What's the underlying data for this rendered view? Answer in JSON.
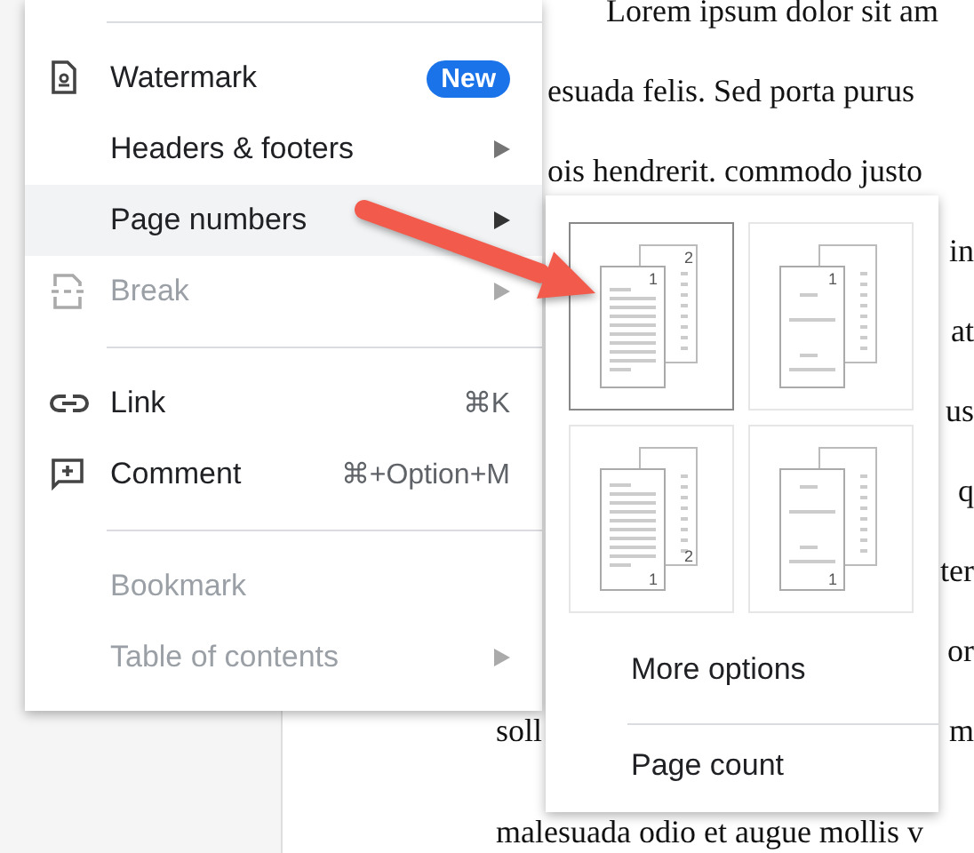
{
  "document": {
    "lines": [
      {
        "text": "Lorem ipsum dolor sit am"
      },
      {
        "text": "esuada felis. Sed porta purus"
      },
      {
        "text": "ois hendrerit. commodo justo"
      },
      {
        "edge_text": "in"
      },
      {
        "edge_text": "at"
      },
      {
        "edge_text": "us"
      },
      {
        "edge_text": "q"
      },
      {
        "edge_text": "ter"
      },
      {
        "edge_text": "or"
      },
      {
        "text": "soll",
        "edge_text": "m"
      },
      {
        "text": "malesuada odio et augue mollis v"
      }
    ]
  },
  "menu": {
    "items": [
      {
        "kind": "watermark",
        "label": "Watermark",
        "badge": "New",
        "submenu": false,
        "disabled": false,
        "selected": false
      },
      {
        "kind": "plain",
        "label": "Headers & footers",
        "submenu": true,
        "disabled": false,
        "selected": false
      },
      {
        "kind": "plain",
        "label": "Page numbers",
        "submenu": true,
        "disabled": false,
        "selected": true
      },
      {
        "kind": "break",
        "label": "Break",
        "submenu": true,
        "disabled": true,
        "selected": false
      },
      {
        "kind": "divider"
      },
      {
        "kind": "link",
        "label": "Link",
        "shortcut": "⌘K",
        "submenu": false,
        "disabled": false,
        "selected": false
      },
      {
        "kind": "comment",
        "label": "Comment",
        "shortcut": "⌘+Option+M",
        "submenu": false,
        "disabled": false,
        "selected": false
      },
      {
        "kind": "divider"
      },
      {
        "kind": "plain",
        "label": "Bookmark",
        "submenu": false,
        "disabled": true,
        "selected": false
      },
      {
        "kind": "plain",
        "label": "Table of contents",
        "submenu": true,
        "disabled": true,
        "selected": false
      }
    ]
  },
  "submenu": {
    "layouts": [
      {
        "kind": "top",
        "numbers": [
          "1",
          "2"
        ],
        "selected": true
      },
      {
        "kind": "top",
        "numbers": [
          "1"
        ],
        "selected": false
      },
      {
        "kind": "bottom",
        "numbers": [
          "1",
          "2"
        ],
        "selected": false
      },
      {
        "kind": "bottom",
        "numbers": [
          "1"
        ],
        "selected": false
      }
    ],
    "items": [
      "More options",
      "Page count"
    ]
  }
}
